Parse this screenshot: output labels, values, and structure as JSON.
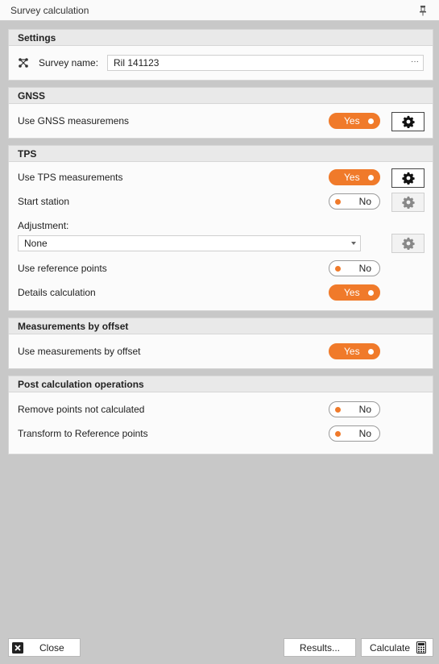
{
  "window": {
    "title": "Survey calculation"
  },
  "settings": {
    "header": "Settings",
    "survey_name_label": "Survey name:",
    "survey_name_value": "Ril 141123",
    "more_glyph": "···"
  },
  "gnss": {
    "header": "GNSS",
    "use_label": "Use GNSS measuremens",
    "use_value": "Yes"
  },
  "tps": {
    "header": "TPS",
    "use_label": "Use TPS measurements",
    "use_value": "Yes",
    "start_station_label": "Start station",
    "start_station_value": "No",
    "adjustment_label": "Adjustment:",
    "adjustment_value": "None",
    "reference_points_label": "Use reference points",
    "reference_points_value": "No",
    "details_label": "Details calculation",
    "details_value": "Yes"
  },
  "offset": {
    "header": "Measurements by offset",
    "use_label": "Use measurements by offset",
    "use_value": "Yes"
  },
  "post": {
    "header": "Post calculation operations",
    "remove_label": "Remove points not calculated",
    "remove_value": "No",
    "transform_label": "Transform to Reference points",
    "transform_value": "No"
  },
  "footer": {
    "close_label": "Close",
    "results_label": "Results...",
    "calculate_label": "Calculate"
  },
  "colors": {
    "accent": "#f07a2a",
    "background": "#c8c8c8"
  }
}
